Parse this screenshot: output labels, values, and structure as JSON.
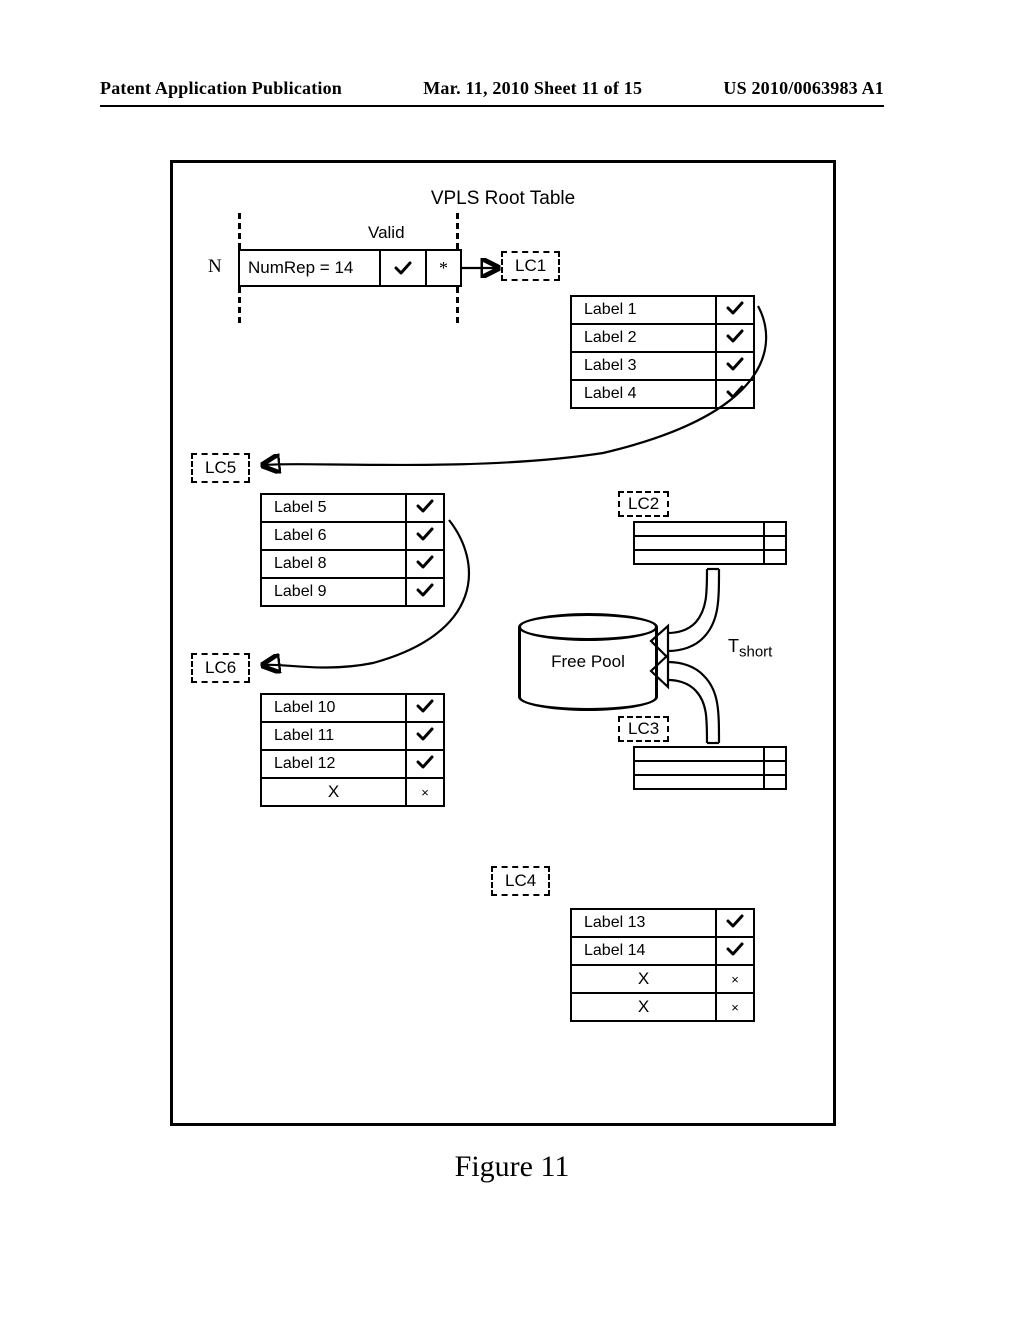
{
  "page_header": {
    "left": "Patent Application Publication",
    "center": "Mar. 11, 2010  Sheet 11 of 15",
    "right": "US 2010/0063983 A1"
  },
  "title": "VPLS Root Table",
  "valid_label": "Valid",
  "root_row": {
    "index": "N",
    "text": "NumRep = 14",
    "star": "*"
  },
  "chunks": {
    "lc1": {
      "name": "LC1",
      "rows": [
        {
          "label": "Label 1",
          "valid": true
        },
        {
          "label": "Label 2",
          "valid": true
        },
        {
          "label": "Label 3",
          "valid": true
        },
        {
          "label": "Label 4",
          "valid": true
        }
      ]
    },
    "lc5": {
      "name": "LC5",
      "rows": [
        {
          "label": "Label 5",
          "valid": true
        },
        {
          "label": "Label 6",
          "valid": true
        },
        {
          "label": "Label 8",
          "valid": true
        },
        {
          "label": "Label 9",
          "valid": true
        }
      ]
    },
    "lc6": {
      "name": "LC6",
      "rows": [
        {
          "label": "Label 10",
          "valid": true
        },
        {
          "label": "Label 11",
          "valid": true
        },
        {
          "label": "Label 12",
          "valid": true
        },
        {
          "label": "X",
          "valid": false
        }
      ]
    },
    "lc4": {
      "name": "LC4",
      "rows": [
        {
          "label": "Label 13",
          "valid": true
        },
        {
          "label": "Label 14",
          "valid": true
        },
        {
          "label": "X",
          "valid": false
        },
        {
          "label": "X",
          "valid": false
        }
      ]
    },
    "lc2": {
      "name": "LC2"
    },
    "lc3": {
      "name": "LC3"
    }
  },
  "free_pool": "Free Pool",
  "tshort": {
    "base": "T",
    "sub": "short"
  },
  "figure_caption": "Figure 11"
}
